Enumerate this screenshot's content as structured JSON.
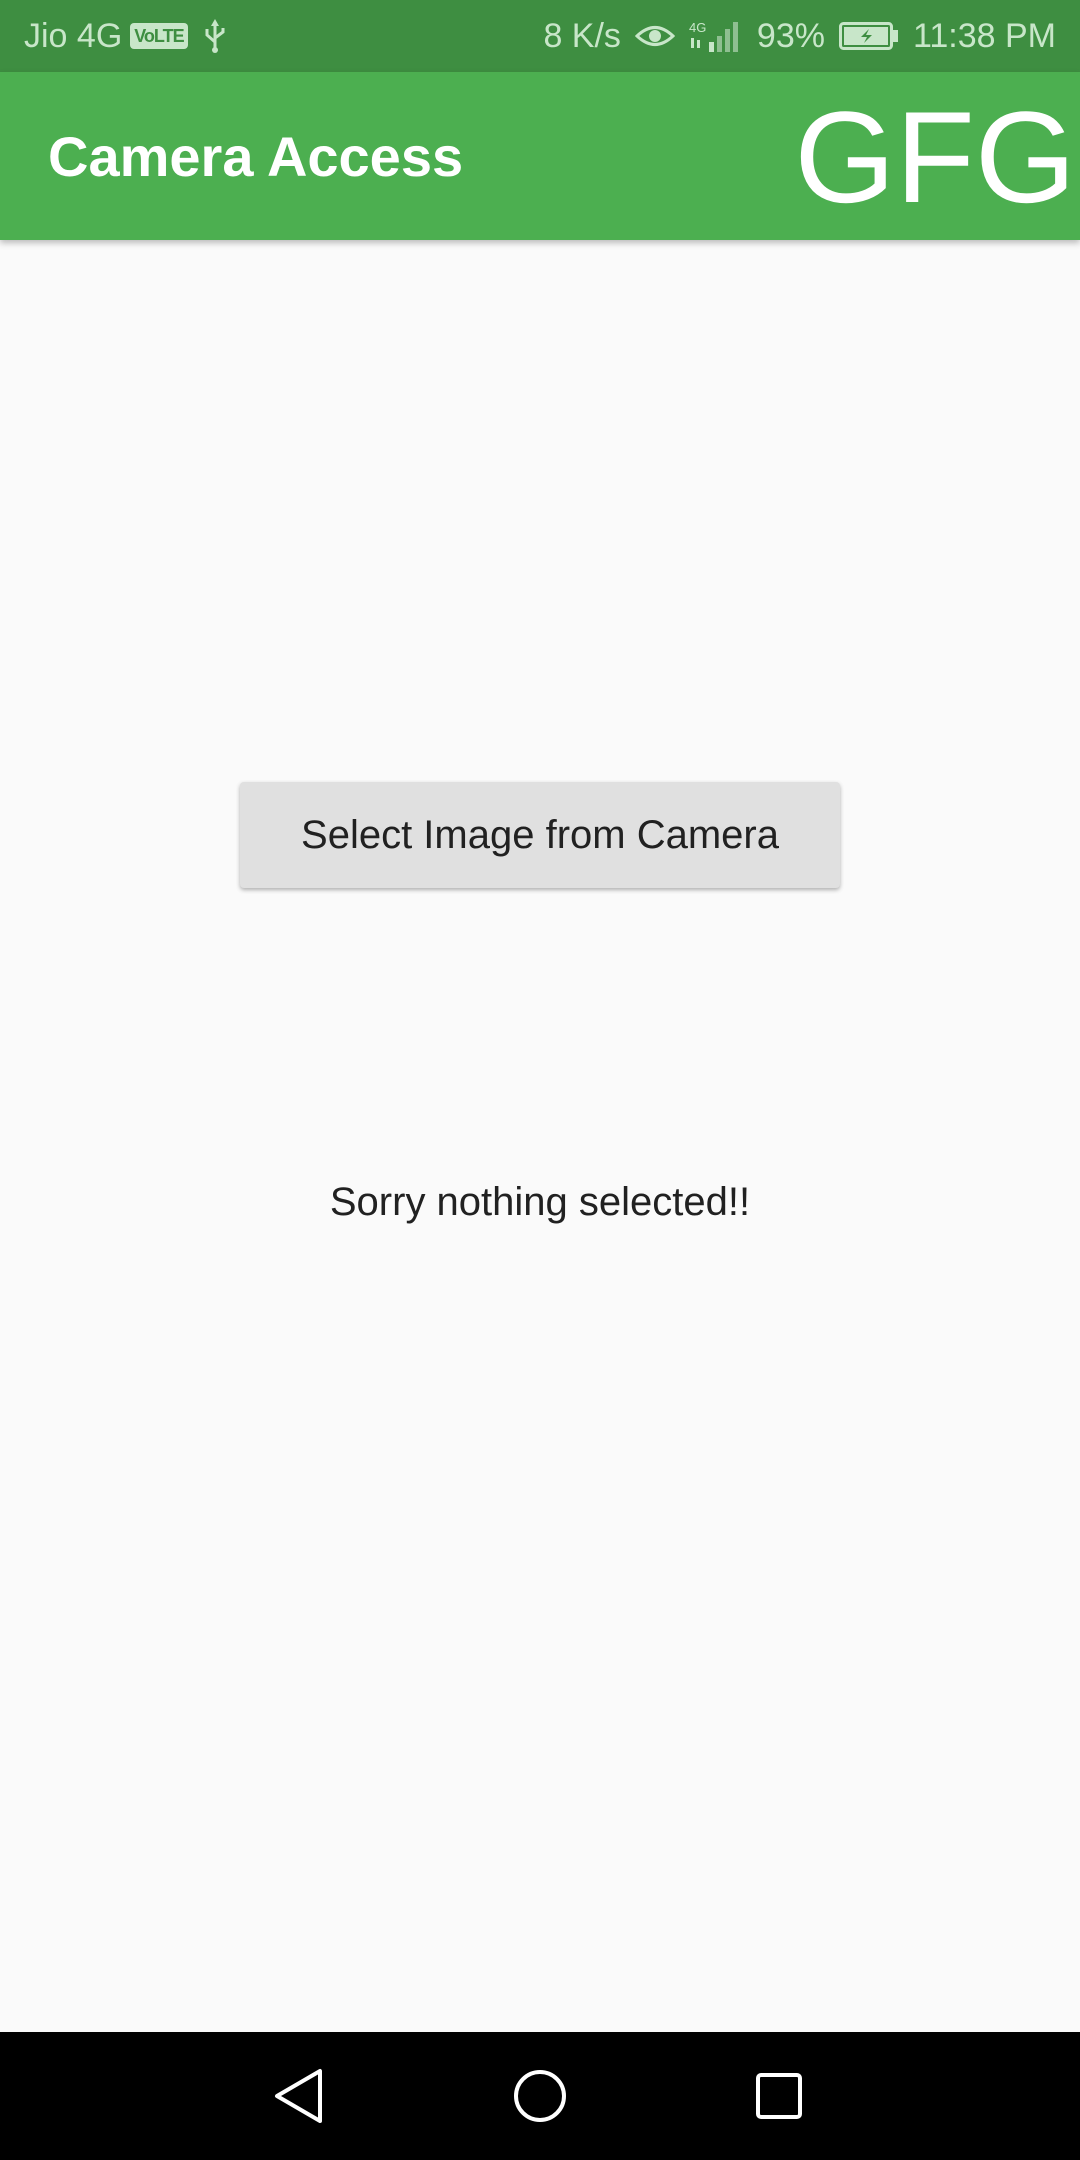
{
  "status_bar": {
    "carrier": "Jio 4G",
    "volte": "VoLTE",
    "network_speed": "8 K/s",
    "battery_percent": "93%",
    "time": "11:38 PM",
    "icons": [
      "usb-icon",
      "eye-icon",
      "signal-icon",
      "battery-icon"
    ]
  },
  "app_bar": {
    "title": "Camera Access",
    "brand": "GFG",
    "color": "#4caf50"
  },
  "main": {
    "button_label": "Select Image from Camera",
    "status_text": "Sorry nothing selected!!"
  },
  "nav_bar": {
    "icons": [
      "back-icon",
      "home-icon",
      "recents-icon"
    ]
  }
}
